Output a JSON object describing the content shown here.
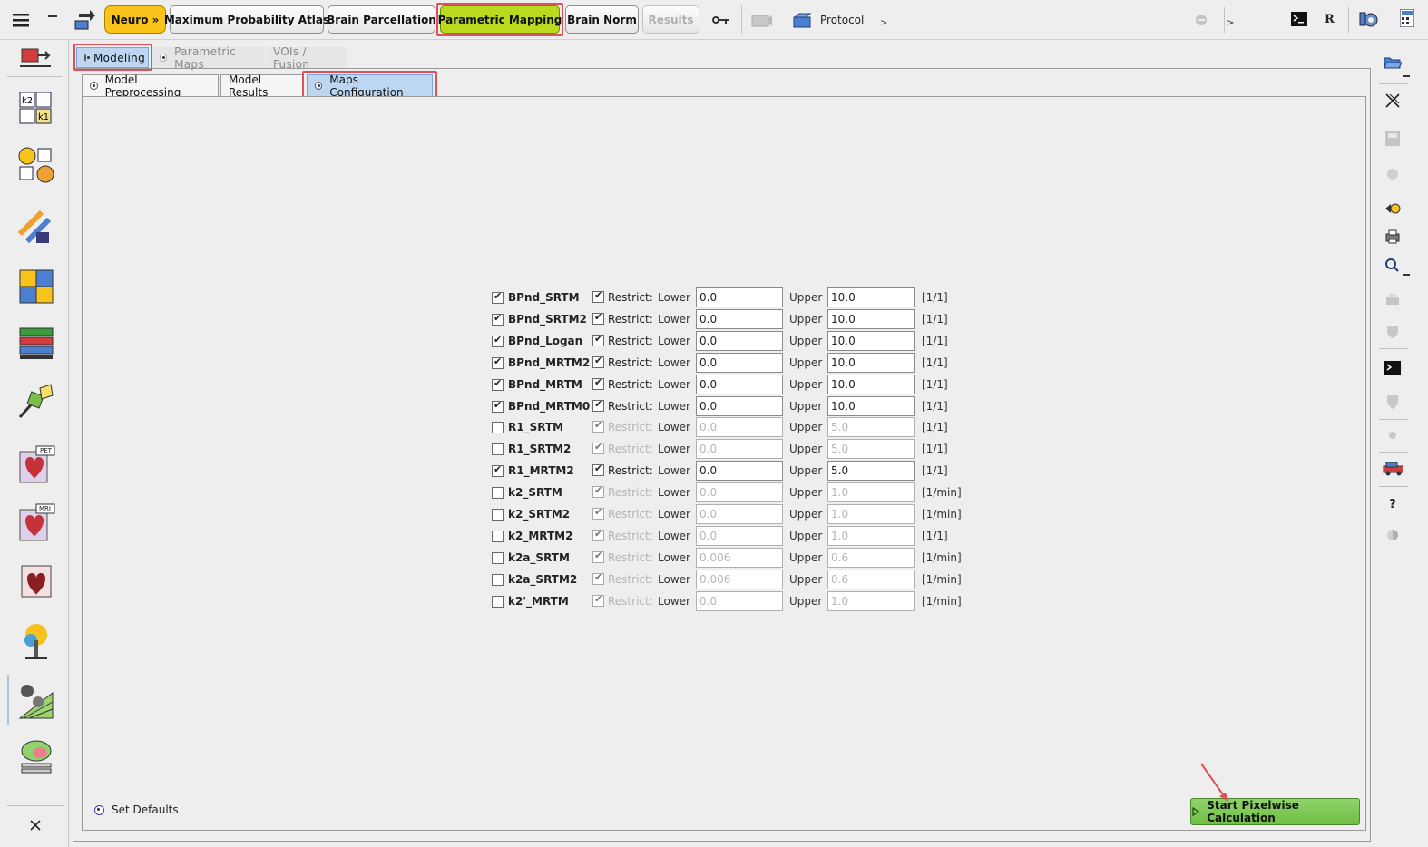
{
  "toolbar": {
    "neuro": "Neuro »",
    "max_prob_atlas": "Maximum Probability Atlas",
    "brain_parcellation": "Brain Parcellation",
    "parametric_mapping": "Parametric Mapping",
    "brain_norm": "Brain Norm",
    "results": "Results",
    "protocol": "Protocol",
    "protocol_arrow": ">",
    "status_arrow": ">",
    "r_label": "R"
  },
  "level1_tabs": {
    "modeling": "Modeling",
    "parametric_maps": "Parametric Maps",
    "vois_fusion": "VOIs / Fusion"
  },
  "level2_tabs": {
    "model_preprocessing": "Model Preprocessing",
    "model_results": "Model Results",
    "maps_configuration": "Maps Configuration"
  },
  "labels": {
    "restrict": "Restrict:",
    "lower": "Lower",
    "upper": "Upper"
  },
  "params": [
    {
      "name": "BPnd_SRTM",
      "checked": true,
      "restrict": true,
      "lower": "0.0",
      "upper": "10.0",
      "unit": "[1/1]"
    },
    {
      "name": "BPnd_SRTM2",
      "checked": true,
      "restrict": true,
      "lower": "0.0",
      "upper": "10.0",
      "unit": "[1/1]"
    },
    {
      "name": "BPnd_Logan",
      "checked": true,
      "restrict": true,
      "lower": "0.0",
      "upper": "10.0",
      "unit": "[1/1]"
    },
    {
      "name": "BPnd_MRTM2",
      "checked": true,
      "restrict": true,
      "lower": "0.0",
      "upper": "10.0",
      "unit": "[1/1]"
    },
    {
      "name": "BPnd_MRTM",
      "checked": true,
      "restrict": true,
      "lower": "0.0",
      "upper": "10.0",
      "unit": "[1/1]"
    },
    {
      "name": "BPnd_MRTM0",
      "checked": true,
      "restrict": true,
      "lower": "0.0",
      "upper": "10.0",
      "unit": "[1/1]"
    },
    {
      "name": "R1_SRTM",
      "checked": false,
      "restrict": true,
      "lower": "0.0",
      "upper": "5.0",
      "unit": "[1/1]"
    },
    {
      "name": "R1_SRTM2",
      "checked": false,
      "restrict": true,
      "lower": "0.0",
      "upper": "5.0",
      "unit": "[1/1]"
    },
    {
      "name": "R1_MRTM2",
      "checked": true,
      "restrict": true,
      "lower": "0.0",
      "upper": "5.0",
      "unit": "[1/1]"
    },
    {
      "name": "k2_SRTM",
      "checked": false,
      "restrict": true,
      "lower": "0.0",
      "upper": "1.0",
      "unit": "[1/min]"
    },
    {
      "name": "k2_SRTM2",
      "checked": false,
      "restrict": true,
      "lower": "0.0",
      "upper": "1.0",
      "unit": "[1/min]"
    },
    {
      "name": "k2_MRTM2",
      "checked": false,
      "restrict": true,
      "lower": "0.0",
      "upper": "1.0",
      "unit": "[1/1]"
    },
    {
      "name": "k2a_SRTM",
      "checked": false,
      "restrict": true,
      "lower": "0.006",
      "upper": "0.6",
      "unit": "[1/min]"
    },
    {
      "name": "k2a_SRTM2",
      "checked": false,
      "restrict": true,
      "lower": "0.006",
      "upper": "0.6",
      "unit": "[1/min]"
    },
    {
      "name": "k2'_MRTM",
      "checked": false,
      "restrict": true,
      "lower": "0.0",
      "upper": "1.0",
      "unit": "[1/min]"
    }
  ],
  "footer": {
    "set_defaults": "Set Defaults",
    "start_button": "Start Pixelwise Calculation"
  },
  "sidebar": {
    "pet": "PET",
    "mri": "MRI",
    "k2": "k2",
    "k1": "k1"
  },
  "colors": {
    "neuro_button": "#f9c31a",
    "active_tab": "#b9da1d",
    "selected_subtab": "#bdd7f3",
    "highlight": "#e0505a",
    "start_button": "#6fbf45"
  }
}
